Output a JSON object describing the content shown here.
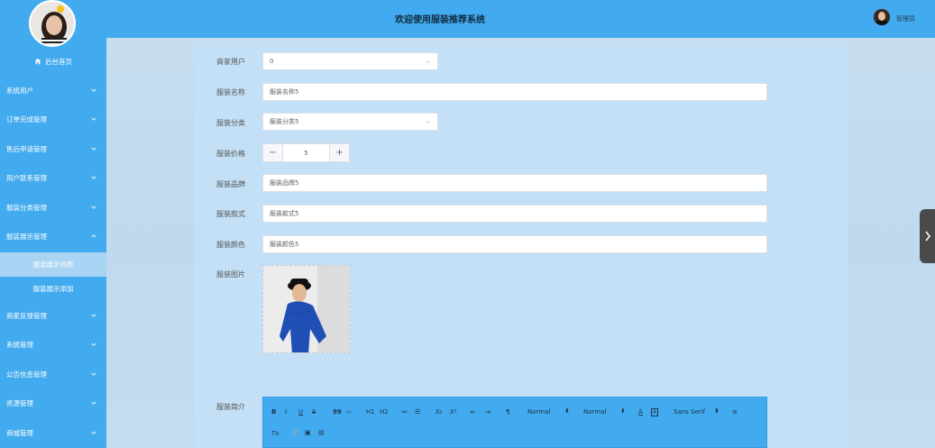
{
  "header": {
    "title": "欢迎使用服装推荐系统",
    "user_label": "管理员"
  },
  "sidebar": {
    "home_label": "后台首页",
    "items": [
      {
        "label": "系统用户"
      },
      {
        "label": "订单完成管理"
      },
      {
        "label": "售后申请管理"
      },
      {
        "label": "用户联系管理"
      },
      {
        "label": "服装分类管理"
      },
      {
        "label": "服装展示管理"
      },
      {
        "label": "商家反馈管理"
      },
      {
        "label": "系统管理"
      },
      {
        "label": "公告信息管理"
      },
      {
        "label": "资源管理"
      },
      {
        "label": "商城管理"
      }
    ],
    "sub_items": [
      {
        "label": "服装展示列表",
        "active": true
      },
      {
        "label": "服装展示添加",
        "active": false
      }
    ]
  },
  "form": {
    "merchant_user": {
      "label": "商家用户",
      "value": "0"
    },
    "name": {
      "label": "服装名称",
      "value": "服装名称5"
    },
    "category": {
      "label": "服装分类",
      "value": "服装分类5"
    },
    "price": {
      "label": "服装价格",
      "value": "5",
      "minus": "−",
      "plus": "+"
    },
    "brand": {
      "label": "服装品牌",
      "value": "服装品牌5"
    },
    "style": {
      "label": "服装款式",
      "value": "服装款式5"
    },
    "color": {
      "label": "服装颜色",
      "value": "服装颜色5"
    },
    "image": {
      "label": "服装图片"
    },
    "intro": {
      "label": "服装简介"
    }
  },
  "editor_toolbar": {
    "bold": "B",
    "italic": "I",
    "underline": "U",
    "strike": "S",
    "quote": "99",
    "code": "‹›",
    "h1": "H1",
    "h2": "H2",
    "ordered": "≔",
    "bullet": "☰",
    "sub": "X₂",
    "sup": "X²",
    "outdent": "⇤",
    "indent": "⇥",
    "direction": "¶",
    "size": "Normal",
    "header": "Normal",
    "font_color": "A",
    "bg_color": "A",
    "font": "Sans Serif",
    "align": "≡",
    "clean": "Tx",
    "link": "🔗",
    "image": "▣",
    "video": "▤"
  },
  "colors": {
    "accent": "#42aaee",
    "panel": "#c3e0f6"
  }
}
